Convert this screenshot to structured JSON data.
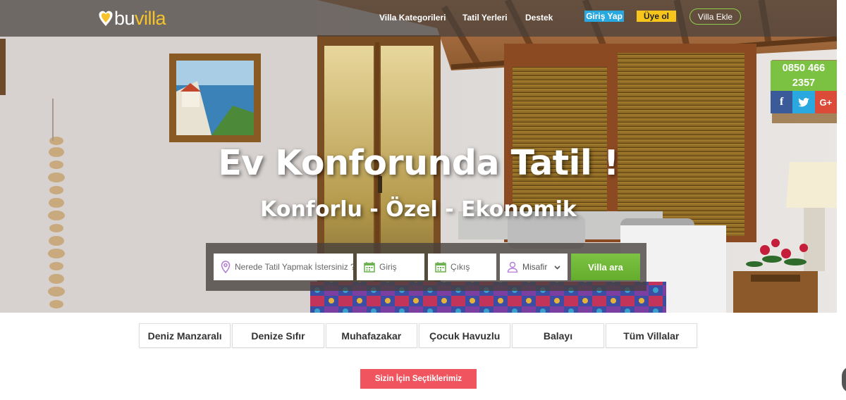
{
  "header": {
    "logo_bu": "bu",
    "logo_villa": "villa",
    "nav": [
      {
        "label": "Villa Kategorileri"
      },
      {
        "label": "Tatil Yerleri"
      },
      {
        "label": "Destek"
      }
    ],
    "login_label": "Giriş Yap",
    "signup_label": "Üye ol",
    "add_villa_label": "Villa Ekle"
  },
  "contact": {
    "phone_line1": "0850 466",
    "phone_line2": "2357",
    "social": [
      {
        "name": "facebook-icon",
        "glyph": "f"
      },
      {
        "name": "twitter-icon",
        "glyph": ""
      },
      {
        "name": "google-plus-icon",
        "glyph": "G+"
      }
    ]
  },
  "hero": {
    "title": "Ev Konforunda Tatil !",
    "subtitle": "Konforlu - Özel - Ekonomik"
  },
  "search": {
    "where_placeholder": "Nerede Tatil Yapmak İstersiniz ?",
    "checkin_placeholder": "Giriş",
    "checkout_placeholder": "Çıkış",
    "guest_value": "Misafir",
    "submit_label": "Villa ara"
  },
  "categories": [
    {
      "label": "Deniz Manzaralı"
    },
    {
      "label": "Denize Sıfır"
    },
    {
      "label": "Muhafazakar"
    },
    {
      "label": "Çocuk Havuzlu"
    },
    {
      "label": "Balayı"
    },
    {
      "label": "Tüm Villalar"
    }
  ],
  "picks_label": "Sizin İçin Seçtiklerimiz",
  "colors": {
    "accent_green": "#7cc242",
    "login_blue": "#29a8e0",
    "signup_yellow": "#f8c51c",
    "picks_red": "#f0555f",
    "logo_yellow": "#f6c32b"
  }
}
